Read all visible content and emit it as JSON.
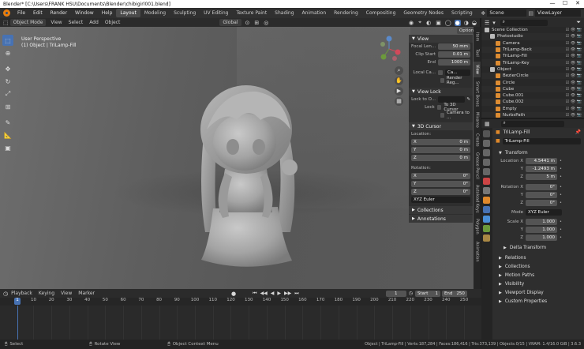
{
  "window": {
    "title": "Blender* [C:\\Users\\FRANK HSU\\Documents\\Blender\\chibigirl001.blend]",
    "controls": [
      "—",
      "☐",
      "✕"
    ]
  },
  "menu": {
    "items": [
      "File",
      "Edit",
      "Render",
      "Window",
      "Help"
    ]
  },
  "workspaces": [
    "Layout",
    "Modeling",
    "Sculpting",
    "UV Editing",
    "Texture Paint",
    "Shading",
    "Animation",
    "Rendering",
    "Compositing",
    "Geometry Nodes",
    "Scripting"
  ],
  "active_workspace": "Layout",
  "scene": "Scene",
  "view_layer": "ViewLayer",
  "viewport_header": {
    "mode": "Object Mode",
    "menus": [
      "View",
      "Select",
      "Add",
      "Object"
    ],
    "transform": "Global",
    "options": "Options"
  },
  "viewport_info": {
    "line1": "User Perspective",
    "line2": "(1) Object | TriLamp-Fill"
  },
  "npanel": {
    "view_header": "View",
    "focal_label": "Focal Len...",
    "focal_value": "50 mm",
    "clip_label": "Clip Start",
    "clip_value": "0.01 m",
    "end_label": "End",
    "end_value": "1000 m",
    "local_label": "Local Ca...",
    "local_value": "Ca...",
    "render_region": "Render Reg...",
    "view_lock_header": "View Lock",
    "lock_to_label": "Lock to O...",
    "lock_label": "Lock",
    "lock_3d": "To 3D Cursor",
    "lock_camera": "Camera to ...",
    "cursor_header": "3D Cursor",
    "location_label": "Location:",
    "loc": [
      {
        "axis": "X",
        "value": "0 m"
      },
      {
        "axis": "Y",
        "value": "0 m"
      },
      {
        "axis": "Z",
        "value": "0 m"
      }
    ],
    "rotation_label": "Rotation:",
    "rot": [
      {
        "axis": "X",
        "value": "0°"
      },
      {
        "axis": "Y",
        "value": "0°"
      },
      {
        "axis": "Z",
        "value": "0°"
      }
    ],
    "rot_mode": "XYZ Euler",
    "collections": "Collections",
    "annotations": "Annotations"
  },
  "vtabs": [
    "Item",
    "Tool",
    "View",
    "Smart Bones",
    "Mixamo",
    "Create",
    "Grease Pencil",
    "Autoload Keys",
    "Polygon",
    "Animation"
  ],
  "timeline": {
    "menus": [
      "Playback",
      "Keying",
      "View",
      "Marker"
    ],
    "current_frame": "1",
    "start_label": "Start",
    "start": "1",
    "end_label": "End",
    "end": "250",
    "ticks": [
      "1",
      "10",
      "20",
      "30",
      "40",
      "50",
      "60",
      "70",
      "80",
      "90",
      "100",
      "110",
      "120",
      "130",
      "140",
      "150",
      "160",
      "170",
      "180",
      "190",
      "200",
      "210",
      "220",
      "230",
      "240",
      "250"
    ]
  },
  "status": {
    "select": "Select",
    "rotate": "Rotate View",
    "context": "Object Context Menu",
    "stats": "Object | TriLamp-Fill | Verts:187,284 | Faces:186,416 | Tris:373,139 | Objects:0/15 | VRAM: 1.4/16.0 GiB | 3.6.3"
  },
  "outliner": {
    "rows": [
      {
        "name": "Scene Collection",
        "indent": 0,
        "color": "#bbbbbb"
      },
      {
        "name": "Photostudio",
        "indent": 1,
        "color": "#bbbbbb"
      },
      {
        "name": "Camera",
        "indent": 2,
        "color": "#dd8c32"
      },
      {
        "name": "TriLamp-Back",
        "indent": 2,
        "color": "#dd8c32"
      },
      {
        "name": "TriLamp-Fill",
        "indent": 2,
        "color": "#dd8c32"
      },
      {
        "name": "TriLamp-Key",
        "indent": 2,
        "color": "#dd8c32"
      },
      {
        "name": "Object",
        "indent": 1,
        "color": "#bbbbbb"
      },
      {
        "name": "BezierCircle",
        "indent": 2,
        "color": "#dd8c32"
      },
      {
        "name": "Circle",
        "indent": 2,
        "color": "#dd8c32"
      },
      {
        "name": "Cube",
        "indent": 2,
        "color": "#dd8c32"
      },
      {
        "name": "Cube.001",
        "indent": 2,
        "color": "#dd8c32"
      },
      {
        "name": "Cube.002",
        "indent": 2,
        "color": "#dd8c32"
      },
      {
        "name": "Empty",
        "indent": 2,
        "color": "#dd8c32"
      },
      {
        "name": "NurbsPath",
        "indent": 2,
        "color": "#dd8c32"
      }
    ]
  },
  "properties": {
    "object_name": "TriLamp-Fill",
    "object_field": "TriLamp-Fill",
    "transform": "Transform",
    "location_label": "Location X",
    "loc": [
      {
        "axis": "Location X",
        "value": "4.5441 m"
      },
      {
        "axis": "Y",
        "value": "-1.2493 m"
      },
      {
        "axis": "Z",
        "value": "5 m"
      }
    ],
    "rot": [
      {
        "axis": "Rotation X",
        "value": "0°"
      },
      {
        "axis": "Y",
        "value": "0°"
      },
      {
        "axis": "Z",
        "value": "0°"
      }
    ],
    "mode_label": "Mode",
    "mode": "XYZ Euler",
    "scale": [
      {
        "axis": "Scale X",
        "value": "1.000"
      },
      {
        "axis": "Y",
        "value": "1.000"
      },
      {
        "axis": "Z",
        "value": "1.000"
      }
    ],
    "delta": "Delta Transform",
    "sections": [
      "Relations",
      "Collections",
      "Motion Paths",
      "Visibility",
      "Viewport Display",
      "Custom Properties"
    ]
  }
}
